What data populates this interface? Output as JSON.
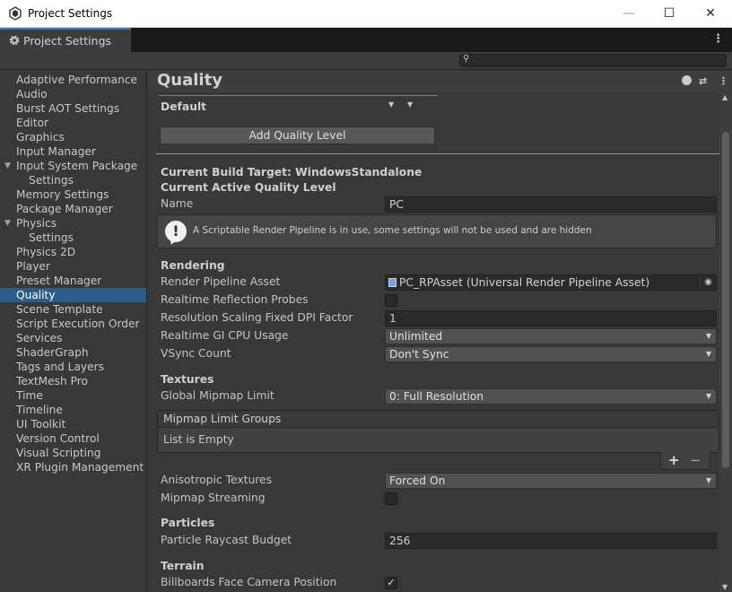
{
  "window": {
    "title": "Project Settings"
  },
  "tab": {
    "label": "Project Settings"
  },
  "search": {
    "placeholder": ""
  },
  "sidebar": {
    "items": [
      {
        "label": "Adaptive Performance"
      },
      {
        "label": "Audio"
      },
      {
        "label": "Burst AOT Settings"
      },
      {
        "label": "Editor"
      },
      {
        "label": "Graphics"
      },
      {
        "label": "Input Manager"
      },
      {
        "label": "Input System Package"
      },
      {
        "label": "Settings"
      },
      {
        "label": "Memory Settings"
      },
      {
        "label": "Package Manager"
      },
      {
        "label": "Physics"
      },
      {
        "label": "Settings"
      },
      {
        "label": "Physics 2D"
      },
      {
        "label": "Player"
      },
      {
        "label": "Preset Manager"
      },
      {
        "label": "Quality"
      },
      {
        "label": "Scene Template"
      },
      {
        "label": "Script Execution Order"
      },
      {
        "label": "Services"
      },
      {
        "label": "ShaderGraph"
      },
      {
        "label": "Tags and Layers"
      },
      {
        "label": "TextMesh Pro"
      },
      {
        "label": "Time"
      },
      {
        "label": "Timeline"
      },
      {
        "label": "UI Toolkit"
      },
      {
        "label": "Version Control"
      },
      {
        "label": "Visual Scripting"
      },
      {
        "label": "XR Plugin Management"
      }
    ],
    "selected": "Quality"
  },
  "content": {
    "title": "Quality",
    "default_label": "Default",
    "add_quality_level": "Add Quality Level",
    "build_target": "Current Build Target: WindowsStandalone",
    "active_level_heading": "Current Active Quality Level",
    "name_label": "Name",
    "name_value": "PC",
    "srp_warning": "A Scriptable Render Pipeline is in use, some settings will not be used and are hidden",
    "rendering": {
      "heading": "Rendering",
      "pipeline_label": "Render Pipeline Asset",
      "pipeline_value": "PC_RPAsset (Universal Render Pipeline Asset)",
      "reflection_label": "Realtime Reflection Probes",
      "dpi_label": "Resolution Scaling Fixed DPI Factor",
      "dpi_value": "1",
      "gi_label": "Realtime GI CPU Usage",
      "gi_value": "Unlimited",
      "vsync_label": "VSync Count",
      "vsync_value": "Don't Sync"
    },
    "textures": {
      "heading": "Textures",
      "mipmap_limit_label": "Global Mipmap Limit",
      "mipmap_limit_value": "0: Full Resolution",
      "groups_header": "Mipmap Limit Groups",
      "groups_empty": "List is Empty",
      "aniso_label": "Anisotropic Textures",
      "aniso_value": "Forced On",
      "streaming_label": "Mipmap Streaming"
    },
    "particles": {
      "heading": "Particles",
      "raycast_label": "Particle Raycast Budget",
      "raycast_value": "256"
    },
    "terrain": {
      "heading": "Terrain",
      "billboards_label": "Billboards Face Camera Position"
    }
  },
  "icons": {
    "plus": "+",
    "minus": "−",
    "check": "✓",
    "warn": "!",
    "help": "?",
    "menu": "⋮"
  }
}
